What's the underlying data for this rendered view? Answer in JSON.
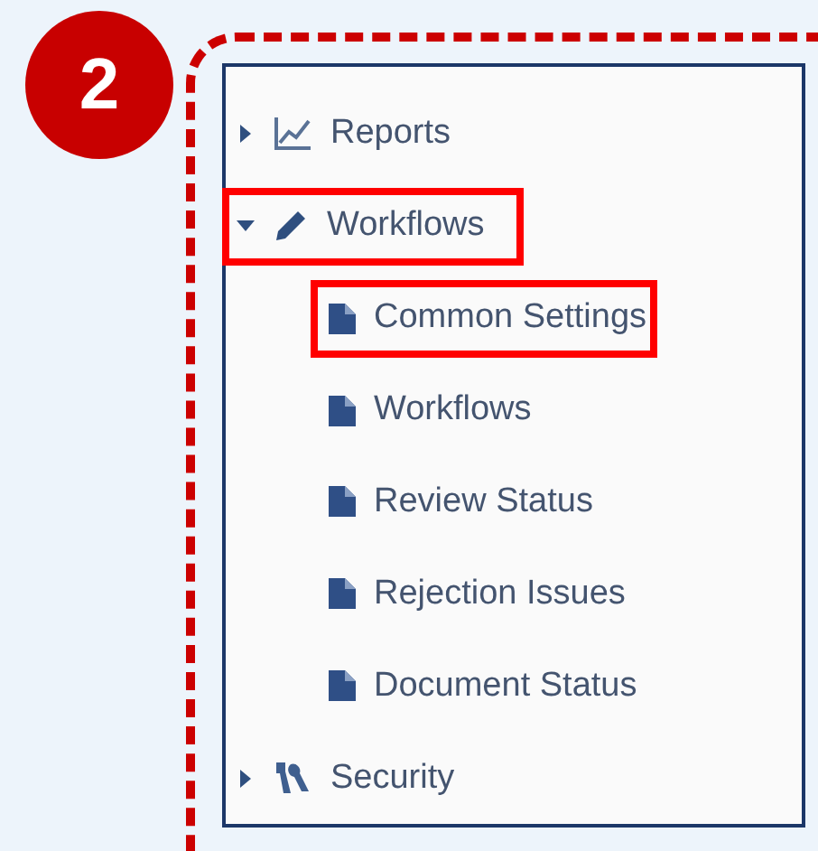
{
  "step_badge": "2",
  "tree": [
    {
      "label": "Reports",
      "kind": "chart",
      "expanded": false,
      "highlighted": false
    },
    {
      "label": "Workflows",
      "kind": "pencil",
      "expanded": true,
      "highlighted": true,
      "children": [
        {
          "label": "Common Settings",
          "kind": "file",
          "highlighted": true
        },
        {
          "label": "Workflows",
          "kind": "file",
          "highlighted": false
        },
        {
          "label": "Review Status",
          "kind": "file",
          "highlighted": false
        },
        {
          "label": "Rejection Issues",
          "kind": "file",
          "highlighted": false
        },
        {
          "label": "Document Status",
          "kind": "file",
          "highlighted": false
        }
      ]
    },
    {
      "label": "Security",
      "kind": "keys",
      "expanded": false,
      "highlighted": false
    }
  ]
}
